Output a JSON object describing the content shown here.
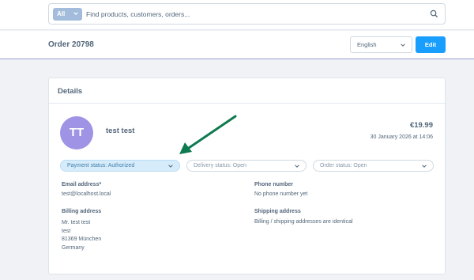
{
  "search": {
    "type_label": "All",
    "placeholder": "Find products, customers, orders..."
  },
  "header": {
    "order_title": "Order 20798",
    "language": "English",
    "edit_label": "Edit"
  },
  "details": {
    "title": "Details",
    "avatar_initials": "TT",
    "customer_name": "test test",
    "amount": "€19.99",
    "date": "30 January 2026 at 14:06",
    "statuses": {
      "payment": "Payment status: Authorized",
      "delivery": "Delivery status: Open",
      "order": "Order status: Open"
    },
    "email_label": "Email address*",
    "email_value": "test@localhost.local",
    "phone_label": "Phone number",
    "phone_value": "No phone number yet",
    "billing_label": "Billing address",
    "billing_lines": [
      "Mr. test test",
      "test",
      "81369 München",
      "Germany"
    ],
    "shipping_label": "Shipping address",
    "shipping_value": "Billing / shipping addresses are identical"
  },
  "colors": {
    "accent": "#189eff",
    "avatar": "#9f93e6",
    "annotation_arrow": "#0f7a4f"
  },
  "icons": [
    "chevron-down-icon",
    "search-icon",
    "annotation-arrow"
  ]
}
